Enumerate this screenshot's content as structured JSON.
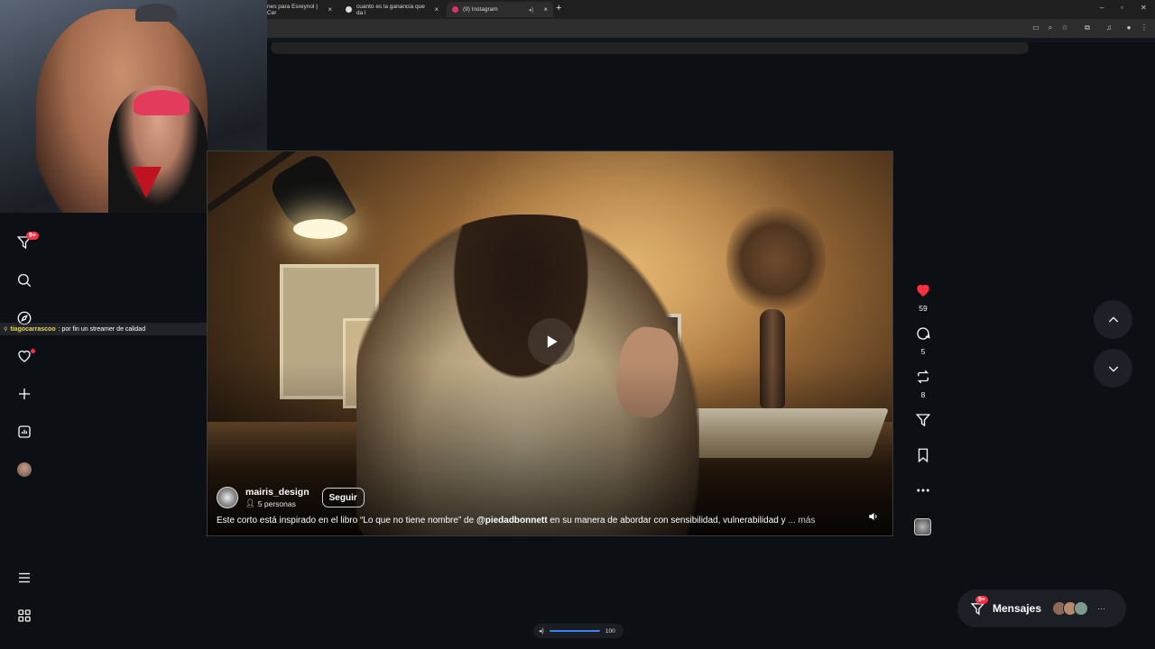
{
  "browser": {
    "tabs": [
      {
        "label": "nes para Esreynol | Cer",
        "active": false
      },
      {
        "label": "cuanto es la ganancia que da l",
        "active": false
      },
      {
        "label": "(9) Instagram",
        "active": true
      }
    ]
  },
  "stream": {
    "chat_user": "tiagocarrascoo",
    "chat_message": ": por fin un streamer de calidad"
  },
  "sidebar": {
    "items": [
      {
        "name": "reels-icon",
        "badge": "9+"
      },
      {
        "name": "search-icon"
      },
      {
        "name": "explore-icon"
      },
      {
        "name": "notifications-icon"
      },
      {
        "name": "create-icon"
      },
      {
        "name": "dashboard-icon"
      },
      {
        "name": "profile-avatar"
      },
      {
        "name": "more-menu-icon"
      },
      {
        "name": "apps-icon"
      }
    ]
  },
  "post": {
    "username": "mairis_design",
    "followers": "5 personas",
    "follow_label": "Seguir",
    "caption_pre": "Este corto está inspirado en el libro “Lo que no tiene nombre” de ",
    "caption_mention": "@piedadbonnett",
    "caption_post": " en su manera de abordar con sensibilidad, vulnerabilidad y ",
    "caption_more": "... más"
  },
  "actions": {
    "likes": "59",
    "comments": "5",
    "reposts": "8"
  },
  "messages": {
    "label": "Mensajes",
    "badge": "9+"
  },
  "volume": {
    "level": "100"
  },
  "colors": {
    "accent": "#ff3040",
    "background": "#0c0f14"
  }
}
